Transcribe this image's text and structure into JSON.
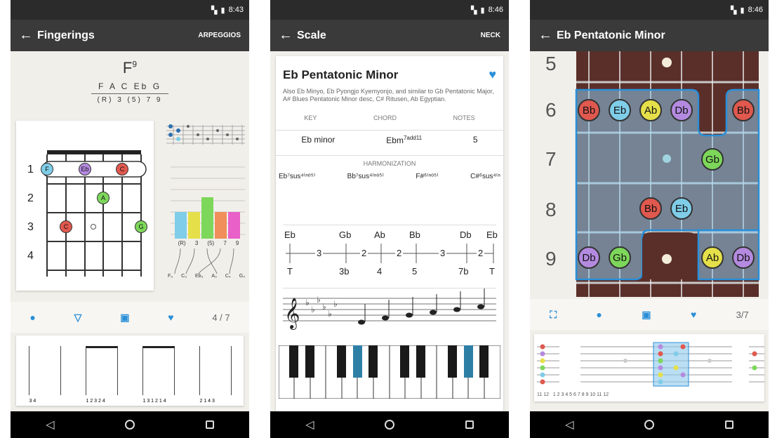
{
  "colors": {
    "blue": "#2a8fd8",
    "red": "#e0584e",
    "cyan": "#7fcde8",
    "yellow": "#e5e04a",
    "purple": "#b48ae0",
    "green": "#7dd75a",
    "orange": "#f08f5a",
    "pink": "#e860c8"
  },
  "status": {
    "time1": "8:43",
    "time2": "8:46",
    "time3": "8:46"
  },
  "screen1": {
    "title": "Fingerings",
    "action": "ARPEGGIOS",
    "chord": "F",
    "chord_sup": "9",
    "notes": [
      "F",
      "A",
      "C",
      "Eb",
      "G"
    ],
    "intervals": [
      "(R)",
      "3",
      "(5)",
      "7",
      "9"
    ],
    "frets": [
      "1",
      "2",
      "3",
      "4"
    ],
    "fret_dots": [
      {
        "label": "F",
        "color": "blue"
      },
      {
        "label": "Eb",
        "color": "purple"
      },
      {
        "label": "C",
        "color": "red"
      },
      {
        "label": "A",
        "color": "green"
      },
      {
        "label": "C",
        "color": "red"
      },
      {
        "label": "G",
        "color": "green"
      }
    ],
    "bar_labels": [
      "(R)",
      "3",
      "(5)",
      "7",
      "9"
    ],
    "bottom_notes": [
      "F₃",
      "C₃",
      "Eb₃",
      "A₃",
      "C₄",
      "G₄"
    ],
    "page": "4 / 7",
    "thumb_labels": [
      "3 4",
      "1 2 3 2 4",
      "1 3 1 2 1 4",
      "2 1 4 3"
    ]
  },
  "screen2": {
    "title": "Scale",
    "action": "NECK",
    "scale_name": "Eb Pentatonic Minor",
    "description": "Also Eb Minyo, Eb Pyongjo Kyemyonjo, and similar to Gb Pentatonic Major, A# Blues Pentatonic Minor desc, C# Ritusen, Ab Egyptian.",
    "key_label": "KEY",
    "chord_label": "CHORD",
    "notes_label": "NOTES",
    "key_value": "Eb minor",
    "chord_value": "Ebm",
    "chord_sup": "7add11",
    "notes_value": "5",
    "harmonization_label": "HARMONIZATION",
    "harmonization": [
      "Eb⁷sus⁴⁽ⁿᵒ⁵⁾",
      "Bb⁷sus⁴⁽ⁿᵒ⁵⁾",
      "F#⁶⁽ⁿᵒ⁵⁾",
      "C#⁶sus⁴⁽ⁿ"
    ],
    "scale_notes": [
      "Eb",
      "Gb",
      "Ab",
      "Bb",
      "Db",
      "Eb"
    ],
    "steps": [
      "3",
      "2",
      "2",
      "3",
      "2"
    ],
    "degrees": [
      "T",
      "3b",
      "4",
      "5",
      "7b",
      "T"
    ]
  },
  "screen3": {
    "title": "Eb Pentatonic Minor",
    "fret_nums": [
      "5",
      "6",
      "7",
      "8",
      "9"
    ],
    "row6": [
      "Bb",
      "Eb",
      "Ab",
      "Db",
      "Bb"
    ],
    "row7": [
      "Gb"
    ],
    "row8": [
      "Bb",
      "Eb"
    ],
    "row9": [
      "Db",
      "Gb",
      "Ab",
      "Db"
    ],
    "page": "3/7",
    "thumb_nums": "11 12   1 2 3 4 5 6 7 8 9 10 11 12"
  },
  "nav": {
    "back": "◁",
    "home": "○",
    "recent": "□"
  }
}
